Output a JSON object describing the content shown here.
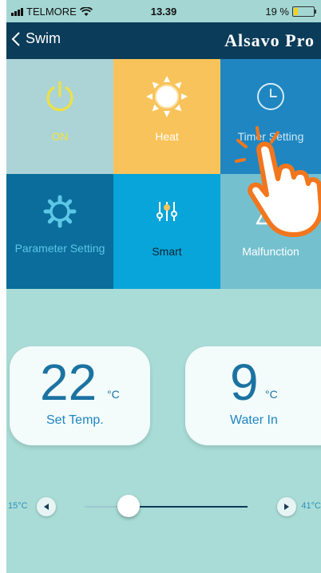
{
  "status_bar": {
    "carrier": "TELMORE",
    "time": "13.39",
    "battery": "19 %",
    "battery_level": 0.19,
    "signal_icon": "signal-bars-icon",
    "wifi_icon": "wifi-icon",
    "battery_icon": "battery-icon"
  },
  "nav": {
    "back_label": "Swim",
    "back_icon": "chevron-left-icon",
    "app_title": "Alsavo Pro"
  },
  "tiles": {
    "on": {
      "label": "ON",
      "icon": "power-icon",
      "color": "#f3e23b"
    },
    "heat": {
      "label": "Heat",
      "icon": "sun-icon"
    },
    "timer": {
      "label": "Timer Setting",
      "icon": "clock-icon"
    },
    "parameter": {
      "label": "Parameter Setting",
      "icon": "gear-icon"
    },
    "smart": {
      "label": "Smart",
      "icon": "sliders-icon"
    },
    "malfunction": {
      "label": "Malfunction",
      "icon": "warning-triangle-icon"
    }
  },
  "overlay": {
    "icon": "tapping-hand-icon",
    "color": "#f2761d"
  },
  "set_temp": {
    "value": "22",
    "unit": "°C",
    "label": "Set Temp."
  },
  "water_in": {
    "value": "9",
    "unit": "°C",
    "label": "Water In"
  },
  "slider": {
    "min_label": "15°C",
    "max_label": "41°C",
    "min": 15,
    "max": 41,
    "value": 22,
    "decrease_icon": "triangle-left-icon",
    "increase_icon": "triangle-right-icon"
  },
  "colors": {
    "nav_bg": "#0b3c59",
    "accent_blue": "#1b73a1",
    "page_bg": "#a9dcd6"
  }
}
